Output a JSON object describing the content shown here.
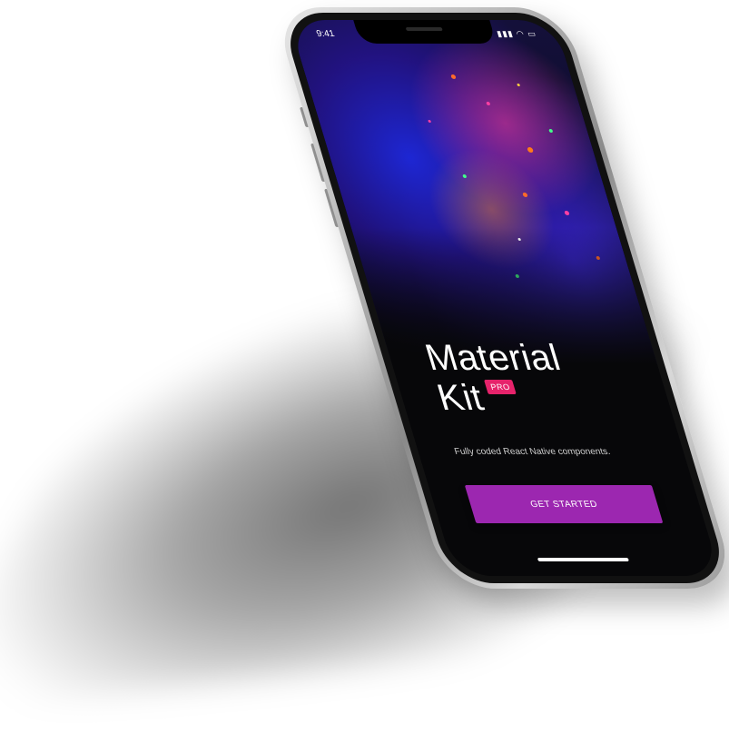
{
  "status_bar": {
    "time": "9:41",
    "icons": "▮▮▮ ◠ ▭"
  },
  "hero": {
    "title_line1": "Material",
    "title_line2": "Kit",
    "badge": "PRO",
    "subtitle": "Fully coded React Native components."
  },
  "cta": {
    "label": "GET STARTED"
  },
  "colors": {
    "accent": "#9c27b0",
    "badge": "#e6236b",
    "screen_bg": "#070709"
  }
}
